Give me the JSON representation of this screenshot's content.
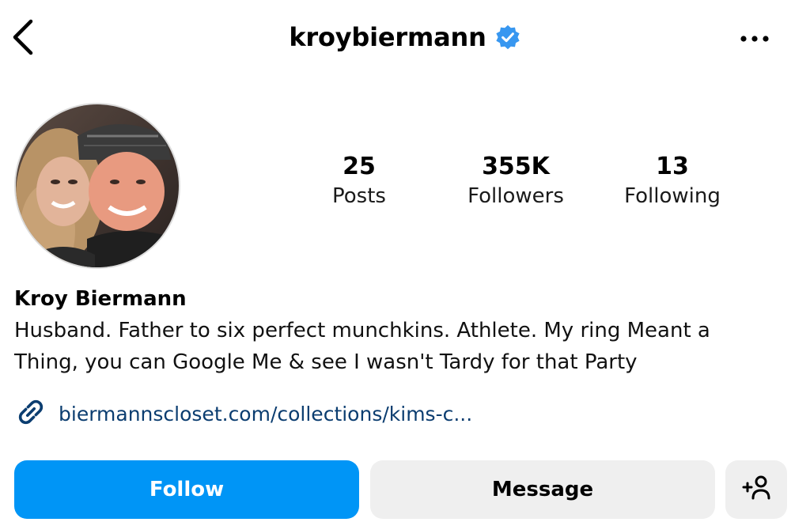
{
  "header": {
    "username": "kroybiermann",
    "verified": true,
    "back_icon": "chevron-left-icon",
    "more_icon": "more-horizontal-icon"
  },
  "profile": {
    "stats": [
      {
        "value": "25",
        "label": "Posts"
      },
      {
        "value": "355K",
        "label": "Followers"
      },
      {
        "value": "13",
        "label": "Following"
      }
    ],
    "display_name": "Kroy Biermann",
    "bio_line1": "Husband. Father to six perfect munchkins. Athlete. My ring Meant a",
    "bio_line2": "Thing, you can Google Me & see I wasn't Tardy for that Party",
    "link": "biermannscloset.com/collections/kims-c..."
  },
  "actions": {
    "follow_label": "Follow",
    "message_label": "Message",
    "add_user_icon": "add-user-icon"
  },
  "colors": {
    "follow_button": "#0095f6",
    "secondary_button": "#efefef",
    "verified_badge": "#3897f0",
    "link": "#0b3d70"
  }
}
